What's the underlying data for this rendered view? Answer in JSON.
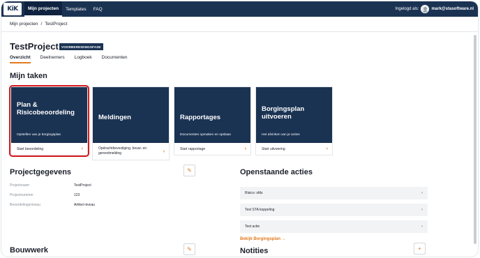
{
  "nav": {
    "logo": "KiK",
    "links": [
      "Mijn projecten",
      "Templates",
      "FAQ"
    ],
    "logged_in_label": "Ingelogd als:",
    "user_email": "mark@stasoftware.nl"
  },
  "breadcrumb": {
    "items": [
      "Mijn projecten",
      "TestProject"
    ],
    "separator": "/"
  },
  "project": {
    "title": "TestProject",
    "phase": "VOORBEREIDINGSFASE"
  },
  "tabs": [
    "Overzicht",
    "Deelnemers",
    "Logboek",
    "Documenten"
  ],
  "tasks": {
    "heading": "Mijn taken",
    "cards": [
      {
        "title": "Plan & Risicobeoordeling",
        "subtitle": "Opstellen van je borgingsplan",
        "action": "Start beoordeling"
      },
      {
        "title": "Meldingen",
        "subtitle": "",
        "action": "Opdrachtbevestiging, bouw- en gereedmelding"
      },
      {
        "title": "Rapportages",
        "subtitle": "Documenten opmaken en opslaan",
        "action": "Start rapportage"
      },
      {
        "title": "Borgingsplan uitvoeren",
        "subtitle": "Het afvinken van je acties",
        "action": "Start uitvoering"
      }
    ]
  },
  "project_data": {
    "heading": "Projectgegevens",
    "fields": [
      {
        "label": "Projectnaam",
        "value": "TestProject"
      },
      {
        "label": "Projectnummer",
        "value": "123"
      },
      {
        "label": "Beoordelingsniveau",
        "value": "Artikel niveau"
      }
    ]
  },
  "open_actions": {
    "heading": "Openstaande acties",
    "items": [
      "Risico: sfds",
      "Test STA koppeling",
      "Test actie"
    ],
    "link": "Bekijk Borgingsplan →"
  },
  "bouwwerk": {
    "heading": "Bouwwerk"
  },
  "notities": {
    "heading": "Notities"
  },
  "icons": {
    "edit": "pencil-icon",
    "add": "plus-icon",
    "chevron": "chevron-right-icon"
  },
  "colors": {
    "navy": "#1b3353",
    "accent": "#e07a1f",
    "highlight": "#d6191e"
  }
}
